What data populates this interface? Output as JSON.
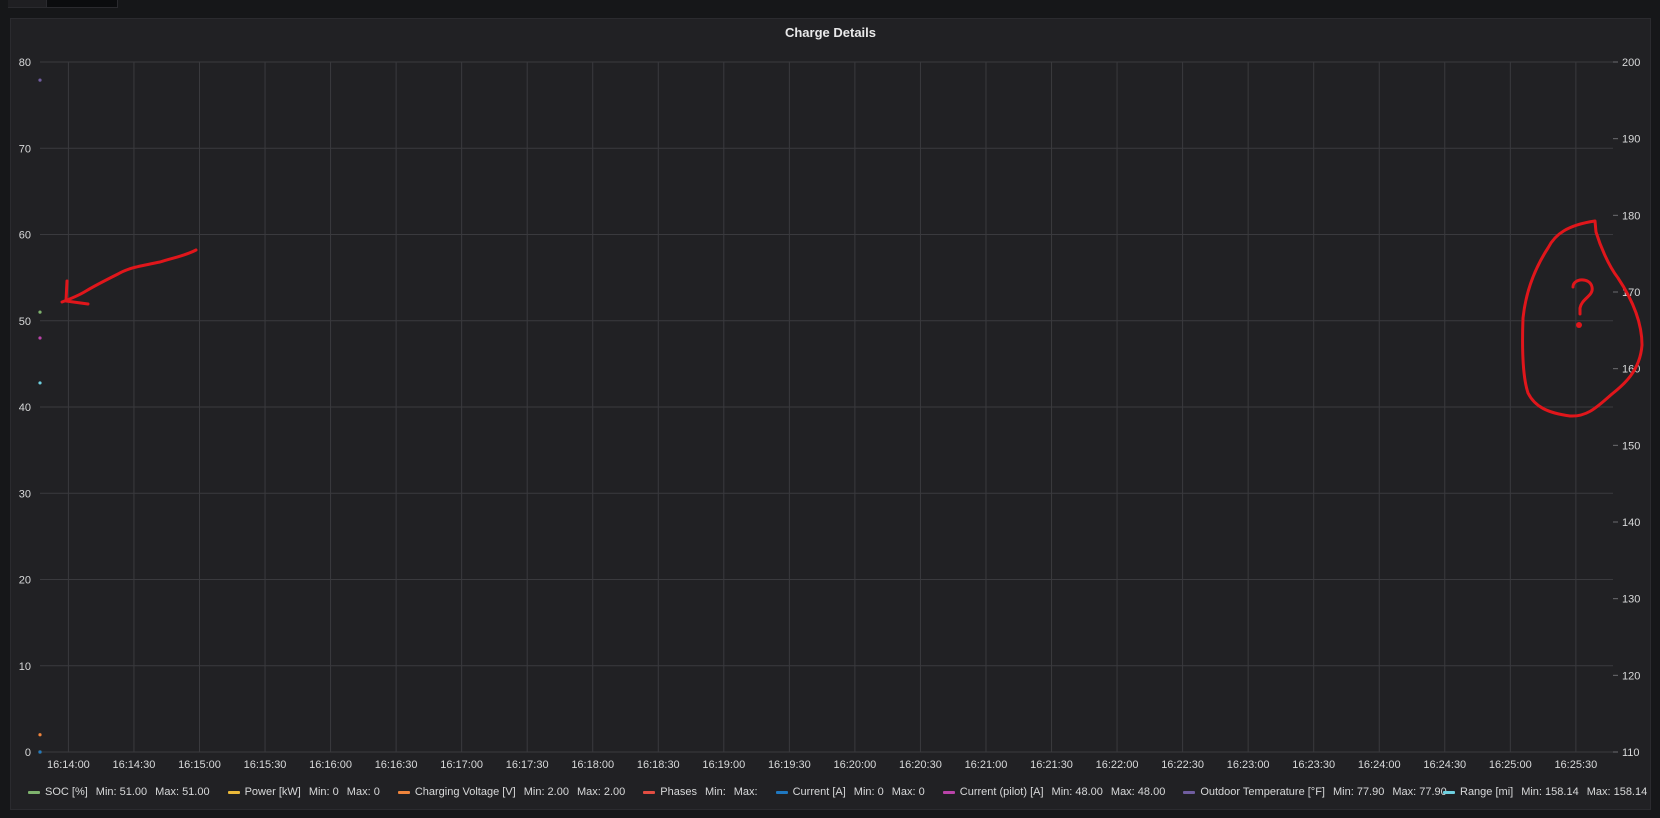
{
  "panel": {
    "title": "Charge Details"
  },
  "chart_data": {
    "type": "line",
    "title": "Charge Details",
    "x_ticks": [
      "16:14:00",
      "16:14:30",
      "16:15:00",
      "16:15:30",
      "16:16:00",
      "16:16:30",
      "16:17:00",
      "16:17:30",
      "16:18:00",
      "16:18:30",
      "16:19:00",
      "16:19:30",
      "16:20:00",
      "16:20:30",
      "16:21:00",
      "16:21:30",
      "16:22:00",
      "16:22:30",
      "16:23:00",
      "16:23:30",
      "16:24:00",
      "16:24:30",
      "16:25:00",
      "16:25:30"
    ],
    "x_range_seconds": {
      "start": "16:13:47",
      "end": "16:25:47"
    },
    "ylim_left": [
      0,
      80
    ],
    "ylim_right": [
      110,
      200
    ],
    "left_ticks": [
      0,
      10,
      20,
      30,
      40,
      50,
      60,
      70,
      80
    ],
    "right_ticks": [
      110,
      120,
      130,
      140,
      150,
      160,
      170,
      180,
      190,
      200
    ],
    "grid": true,
    "legend_position": "bottom",
    "series": [
      {
        "name": "SOC [%]",
        "color": "#7eb26d",
        "axis": "left",
        "points": [
          {
            "x": "16:13:47",
            "y": 51.0
          }
        ],
        "min": "51.00",
        "max": "51.00"
      },
      {
        "name": "Power [kW]",
        "color": "#eab839",
        "axis": "left",
        "points": [
          {
            "x": "16:13:47",
            "y": 0
          }
        ],
        "min": "0",
        "max": "0"
      },
      {
        "name": "Charging Voltage [V]",
        "color": "#ef843c",
        "axis": "left",
        "points": [
          {
            "x": "16:13:47",
            "y": 2.0
          }
        ],
        "min": "2.00",
        "max": "2.00"
      },
      {
        "name": "Phases",
        "color": "#e24d42",
        "axis": "left",
        "points": [],
        "min": "",
        "max": ""
      },
      {
        "name": "Current [A]",
        "color": "#1f78c1",
        "axis": "left",
        "points": [
          {
            "x": "16:13:47",
            "y": 0
          }
        ],
        "min": "0",
        "max": "0"
      },
      {
        "name": "Current (pilot) [A]",
        "color": "#ba43a9",
        "axis": "left",
        "points": [
          {
            "x": "16:13:47",
            "y": 48.0
          }
        ],
        "min": "48.00",
        "max": "48.00"
      },
      {
        "name": "Outdoor Temperature [°F]",
        "color": "#705da0",
        "axis": "left",
        "points": [
          {
            "x": "16:13:47",
            "y": 77.9
          }
        ],
        "min": "77.90",
        "max": "77.90"
      },
      {
        "name": "Range [mi]",
        "color": "#6ed0e0",
        "axis": "right",
        "points": [
          {
            "x": "16:13:47",
            "y": 158.14
          }
        ],
        "min": "158.14",
        "max": "158.14"
      }
    ]
  },
  "legend": {
    "min_label": "Min:",
    "max_label": "Max:"
  },
  "annotations": {
    "arrow_color": "#e0161b",
    "question_mark": "?"
  }
}
